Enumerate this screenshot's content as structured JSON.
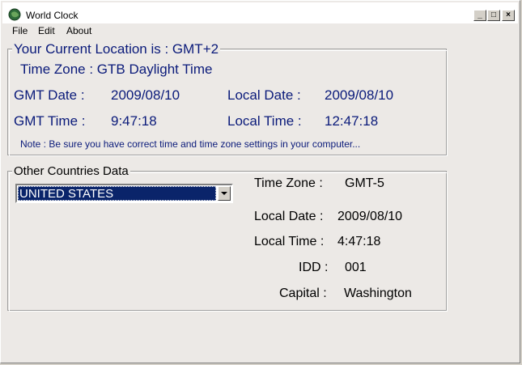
{
  "window": {
    "title": "World Clock",
    "controls": [
      "_",
      "□",
      "×"
    ]
  },
  "menu": [
    "File",
    "Edit",
    "About"
  ],
  "current": {
    "location_label": "Your Current Location is : GMT+2",
    "timezone_label": "Time Zone : GTB Daylight Time",
    "gmt_date_label": "GMT Date :",
    "gmt_date_value": "2009/08/10",
    "local_date_label": "Local Date :",
    "local_date_value": "2009/08/10",
    "gmt_time_label": "GMT Time :",
    "gmt_time_value": "9:47:18",
    "local_time_label": "Local Time :",
    "local_time_value": "12:47:18",
    "note": "Note : Be sure you have correct time and time zone settings in your computer..."
  },
  "other": {
    "legend": "Other Countries Data",
    "selected_country": "UNITED STATES",
    "timezone_label": "Time Zone  :",
    "timezone_value": "GMT-5",
    "local_date_label": "Local Date :",
    "local_date_value": "2009/08/10",
    "local_time_label": "Local Time :",
    "local_time_value": "4:47:18",
    "idd_label": "IDD :",
    "idd_value": "001",
    "capital_label": "Capital :",
    "capital_value": "Washington"
  },
  "colors": {
    "label_blue": "#0a1a7a",
    "selection": "#0a246a",
    "face": "#ece9e6"
  }
}
